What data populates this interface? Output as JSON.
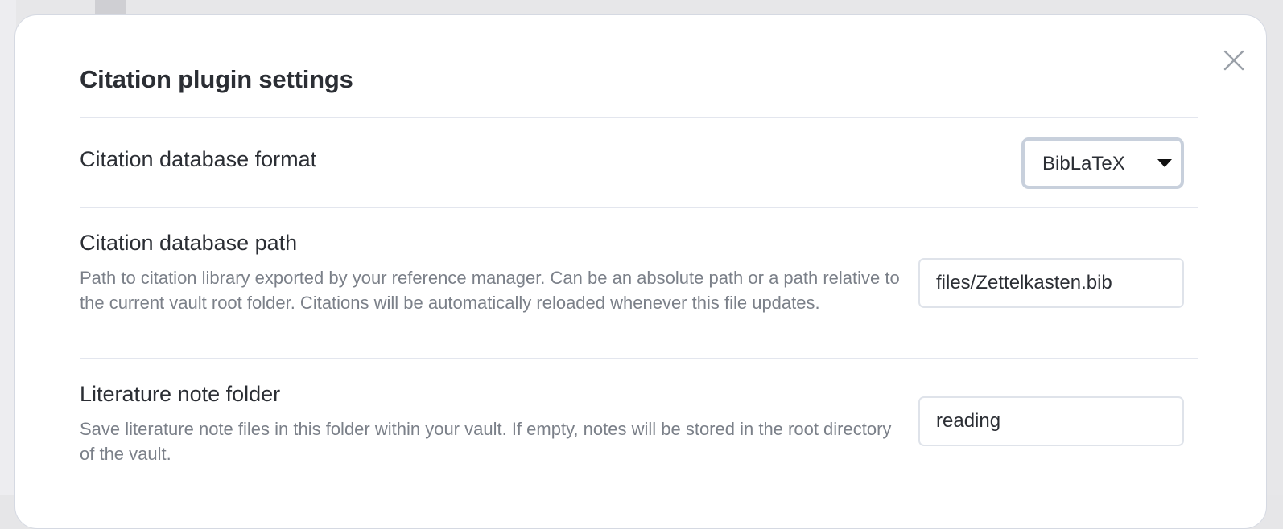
{
  "modal": {
    "title": "Citation plugin settings",
    "close_icon": "close-icon"
  },
  "settings": {
    "format": {
      "name": "Citation database format",
      "selected": "BibLaTeX"
    },
    "path": {
      "name": "Citation database path",
      "description": "Path to citation library exported by your reference manager. Can be an absolute path or a path relative to the current vault root folder. Citations will be automatically reloaded whenever this file updates.",
      "value": "files/Zettelkasten.bib"
    },
    "folder": {
      "name": "Literature note folder",
      "description": "Save literature note files in this folder within your vault. If empty, notes will be stored in the root directory of the vault.",
      "value": "reading"
    }
  },
  "colors": {
    "text": "#2b2e34",
    "muted": "#7b8089",
    "divider": "#e3e6ee",
    "focus_border": "#c8d0dc"
  }
}
